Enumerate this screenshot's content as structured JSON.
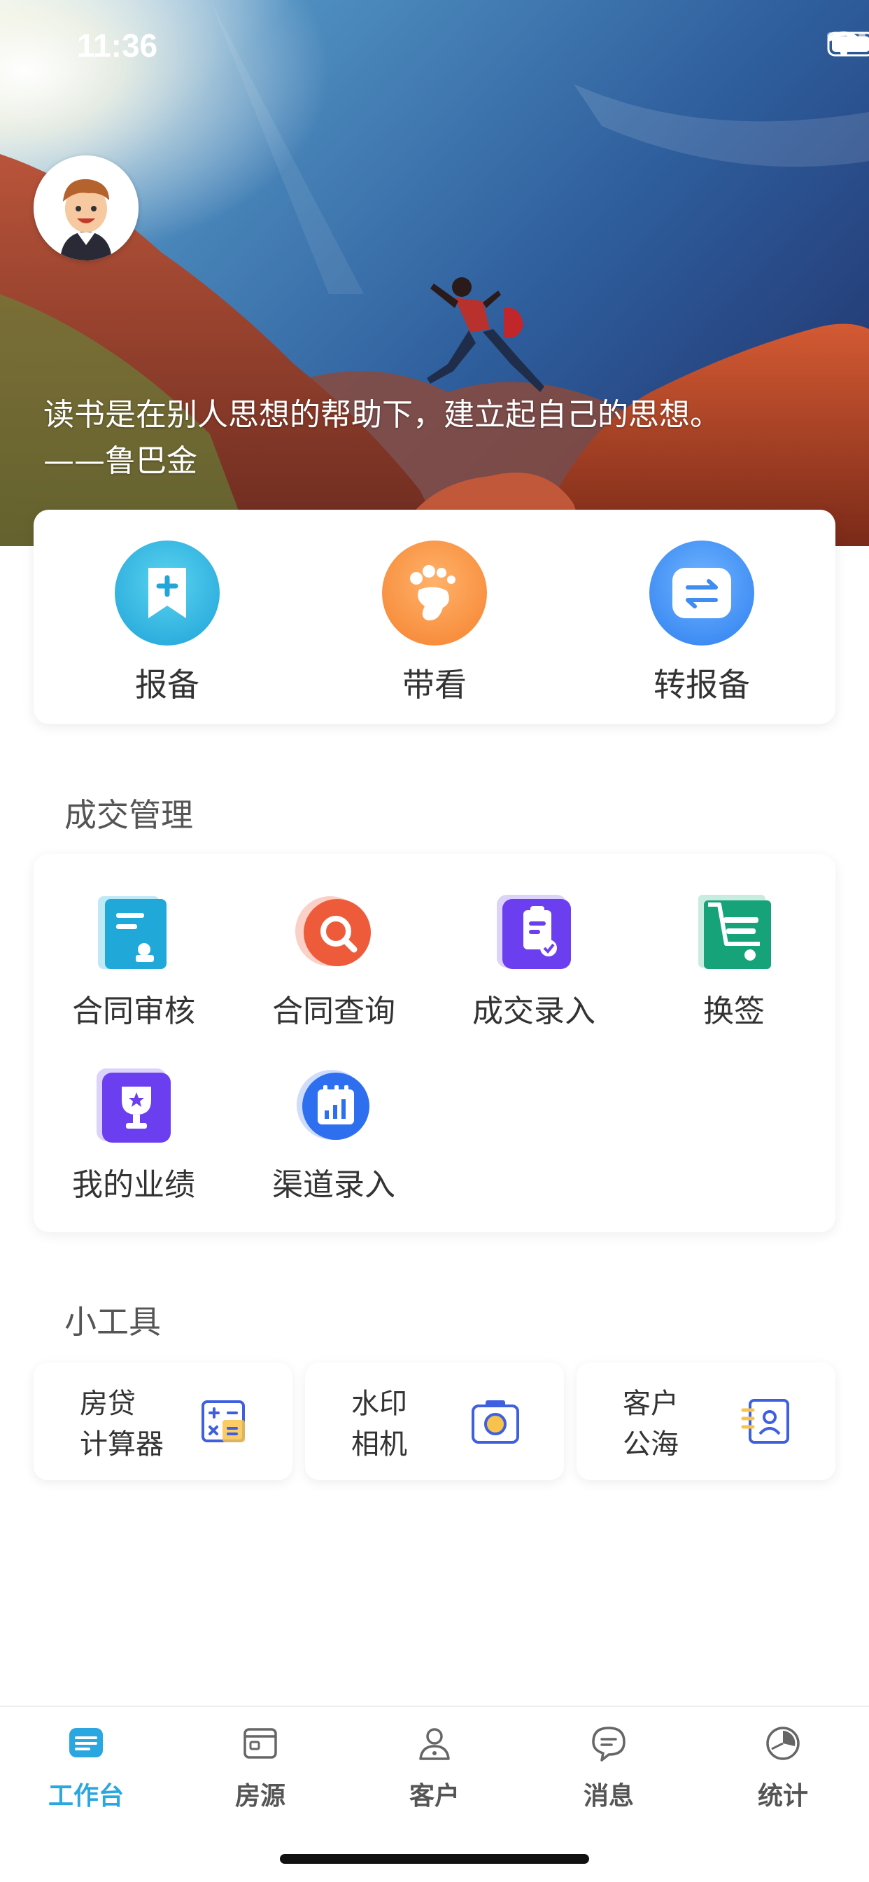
{
  "status_bar": {
    "time": "11:36"
  },
  "hero": {
    "quote_line1": "读书是在别人思想的帮助下，建立起自己的思想。",
    "quote_line2": "——鲁巴金"
  },
  "quick_actions": [
    {
      "label": "报备",
      "icon": "bookmark-plus-icon",
      "color": "#33b4e0"
    },
    {
      "label": "带看",
      "icon": "footprint-icon",
      "color": "#f78c39"
    },
    {
      "label": "转报备",
      "icon": "transfer-icon",
      "color": "#3e8ff2"
    }
  ],
  "deal_section": {
    "title": "成交管理",
    "items": [
      {
        "label": "合同审核",
        "icon": "contract-review-icon",
        "color": "#1fa8d8"
      },
      {
        "label": "合同查询",
        "icon": "contract-search-icon",
        "color": "#ee5b3a"
      },
      {
        "label": "成交录入",
        "icon": "deal-entry-icon",
        "color": "#6b3ff0"
      },
      {
        "label": "换签",
        "icon": "cart-swap-icon",
        "color": "#17a37a"
      },
      {
        "label": "我的业绩",
        "icon": "trophy-icon",
        "color": "#6b3ff0"
      },
      {
        "label": "渠道录入",
        "icon": "channel-entry-icon",
        "color": "#2e6ff0"
      }
    ]
  },
  "tools_section": {
    "title": "小工具",
    "items": [
      {
        "line1": "房贷",
        "line2": "计算器",
        "icon": "calculator-icon"
      },
      {
        "line1": "水印",
        "line2": "相机",
        "icon": "camera-icon"
      },
      {
        "line1": "客户",
        "line2": "公海",
        "icon": "contact-card-icon"
      }
    ]
  },
  "tabbar": {
    "active": "工作台",
    "accent": "#2aa7e0",
    "items": [
      {
        "label": "工作台",
        "icon": "workbench-icon"
      },
      {
        "label": "房源",
        "icon": "house-listing-icon"
      },
      {
        "label": "客户",
        "icon": "customer-icon"
      },
      {
        "label": "消息",
        "icon": "message-icon"
      },
      {
        "label": "统计",
        "icon": "statistics-icon"
      }
    ]
  }
}
